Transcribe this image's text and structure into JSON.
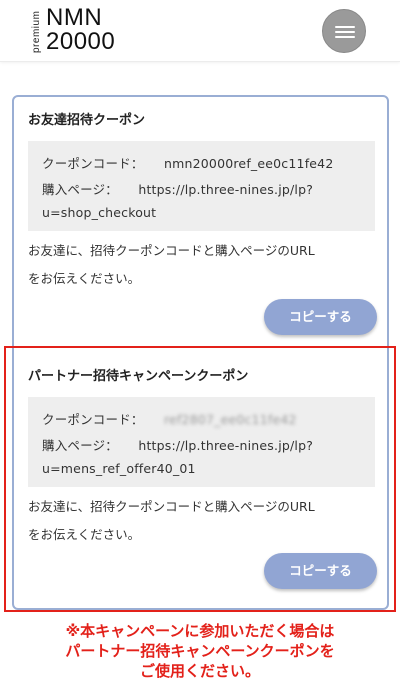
{
  "header": {
    "logo_vertical": "premium",
    "logo_line1": "NMN",
    "logo_line2": "20000",
    "menu_icon": "hamburger-menu-icon"
  },
  "friend_coupon": {
    "title": "お友達招待クーポン",
    "code_label": "クーポンコード：",
    "code_value": "nmn20000ref_ee0c11fe42",
    "page_label": "購入ページ：",
    "page_value_line1": "https://lp.three-nines.jp/lp?",
    "page_value_line2": "u=shop_checkout",
    "desc_line1": "お友達に、招待クーポンコードと購入ページのURL",
    "desc_line2": "をお伝えください。",
    "copy_label": "コピーする"
  },
  "partner_coupon": {
    "title": "パートナー招待キャンペーンクーポン",
    "code_label": "クーポンコード：",
    "code_value": "ref2807_ee0c11fe42",
    "page_label": "購入ページ：",
    "page_value_line1": "https://lp.three-nines.jp/lp?",
    "page_value_line2": "u=mens_ref_offer40_01",
    "desc_line1": "お友達に、招待クーポンコードと購入ページのURL",
    "desc_line2": "をお伝えください。",
    "copy_label": "コピーする"
  },
  "notice": {
    "line1": "※本キャンペーンに参加いただく場合は",
    "line2": "パートナー招待キャンペーンクーポンを",
    "line3": "ご使用ください。"
  },
  "colors": {
    "accent": "#91a5d3",
    "panel_border": "#9aaed4",
    "highlight": "#e3211a"
  }
}
